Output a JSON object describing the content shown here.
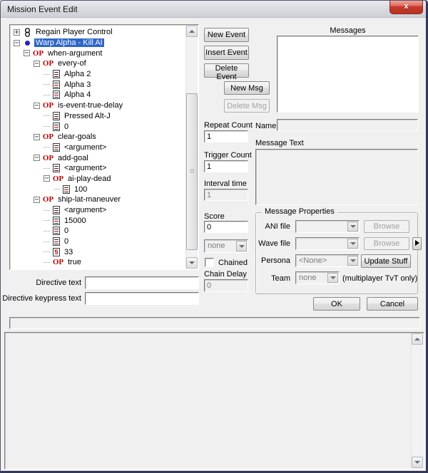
{
  "window": {
    "title": "Mission Event Edit",
    "close_glyph": "x"
  },
  "colors": {
    "selection_blue": "#2E66C8",
    "op_red": "#BE0000",
    "close_button_red": "#C53B2D",
    "dialog_bg": "#F0F0F0"
  },
  "tree": {
    "items": [
      {
        "label": "Regain Player Control",
        "level": 0,
        "expand": "plus",
        "icon": "chain",
        "selected": false
      },
      {
        "label": "Warp Alpha - Kill AI",
        "level": 0,
        "expand": "minus",
        "icon": "event-dot",
        "selected": true
      },
      {
        "label": "when-argument",
        "level": 1,
        "expand": "minus",
        "icon": "op",
        "selected": false
      },
      {
        "label": "every-of",
        "level": 2,
        "expand": "minus",
        "icon": "op",
        "selected": false
      },
      {
        "label": "Alpha 2",
        "level": 3,
        "expand": "none",
        "icon": "data",
        "selected": false
      },
      {
        "label": "Alpha 3",
        "level": 3,
        "expand": "none",
        "icon": "data",
        "selected": false
      },
      {
        "label": "Alpha 4",
        "level": 3,
        "expand": "none",
        "icon": "data",
        "selected": false
      },
      {
        "label": "is-event-true-delay",
        "level": 2,
        "expand": "minus",
        "icon": "op",
        "selected": false
      },
      {
        "label": "Pressed Alt-J",
        "level": 3,
        "expand": "none",
        "icon": "data",
        "selected": false
      },
      {
        "label": "0",
        "level": 3,
        "expand": "none",
        "icon": "data",
        "selected": false
      },
      {
        "label": "clear-goals",
        "level": 2,
        "expand": "minus",
        "icon": "op",
        "selected": false
      },
      {
        "label": "<argument>",
        "level": 3,
        "expand": "none",
        "icon": "data",
        "selected": false
      },
      {
        "label": "add-goal",
        "level": 2,
        "expand": "minus",
        "icon": "op",
        "selected": false
      },
      {
        "label": "<argument>",
        "level": 3,
        "expand": "none",
        "icon": "data",
        "selected": false
      },
      {
        "label": "ai-play-dead",
        "level": 3,
        "expand": "minus",
        "icon": "op",
        "selected": false
      },
      {
        "label": "100",
        "level": 4,
        "expand": "none",
        "icon": "data",
        "selected": false
      },
      {
        "label": "ship-lat-maneuver",
        "level": 2,
        "expand": "minus",
        "icon": "op",
        "selected": false
      },
      {
        "label": "<argument>",
        "level": 3,
        "expand": "none",
        "icon": "data",
        "selected": false
      },
      {
        "label": "15000",
        "level": 3,
        "expand": "none",
        "icon": "data",
        "selected": false
      },
      {
        "label": "0",
        "level": 3,
        "expand": "none",
        "icon": "data",
        "selected": false
      },
      {
        "label": "0",
        "level": 3,
        "expand": "none",
        "icon": "data",
        "selected": false
      },
      {
        "label": "33",
        "level": 3,
        "expand": "none",
        "icon": "number",
        "selected": false
      },
      {
        "label": "true",
        "level": 3,
        "expand": "none",
        "icon": "op",
        "selected": false
      }
    ]
  },
  "event_buttons": {
    "new_event": "New Event",
    "insert_event": "Insert Event",
    "delete_event": "Delete Event"
  },
  "message_buttons": {
    "new_msg": "New Msg",
    "delete_msg": "Delete Msg"
  },
  "messages": {
    "label": "Messages",
    "name_label": "Name",
    "name_value": "",
    "message_text_label": "Message Text",
    "message_text_value": ""
  },
  "event_fields": {
    "repeat_count_label": "Repeat Count",
    "repeat_count_value": "1",
    "trigger_count_label": "Trigger Count",
    "trigger_count_value": "1",
    "interval_time_label": "Interval time",
    "interval_time_value": "1",
    "score_label": "Score",
    "score_value": "0",
    "event_type_value": "none",
    "chained_label": "Chained",
    "chain_delay_label": "Chain Delay",
    "chain_delay_value": "0"
  },
  "message_properties": {
    "title": "Message Properties",
    "ani_file_label": "ANI file",
    "ani_file_value": "",
    "ani_browse": "Browse",
    "wave_file_label": "Wave file",
    "wave_file_value": "",
    "wave_browse": "Browse",
    "persona_label": "Persona",
    "persona_value": "<None>",
    "update_button": "Update Stuff",
    "team_label": "Team",
    "team_value": "none",
    "team_note": "(multiplayer TvT only)"
  },
  "directives": {
    "directive_text_label": "Directive text",
    "directive_text_value": "",
    "directive_keypress_label": "Directive keypress text",
    "directive_keypress_value": ""
  },
  "footer": {
    "ok": "OK",
    "cancel": "Cancel"
  }
}
